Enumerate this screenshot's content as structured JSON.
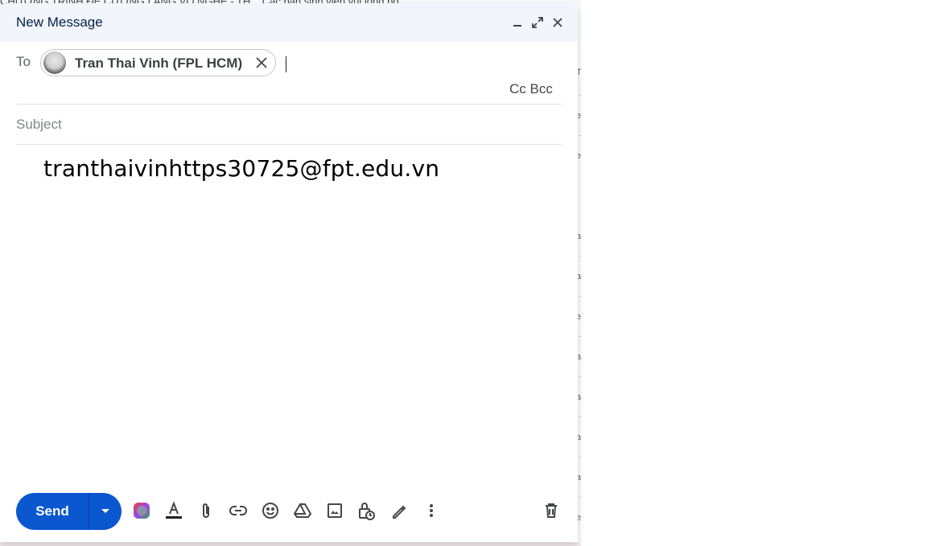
{
  "background": {
    "top_text": "CHƯƠNG TRÌNH ĐỀ CƯƠNG LÀNG VÕ NGHỆ - TH... Các bạn sinh viên vui lòng bổ ...",
    "row_letters": [
      "T",
      "e",
      "e",
      "a",
      "a",
      "e",
      "a",
      "a",
      "a",
      "a",
      "e"
    ]
  },
  "compose": {
    "title": "New Message",
    "to_label": "To",
    "recipient": {
      "name": "Tran Thai Vinh (FPL HCM)"
    },
    "cc_label": "Cc",
    "bcc_label": "Bcc",
    "subject_placeholder": "Subject",
    "body": "tranthaivinhttps30725@fpt.edu.vn",
    "send_label": "Send",
    "icons": {
      "minimize": "minimize-icon",
      "popout": "popout-icon",
      "close": "close-icon",
      "formatting": "formatting-options-icon",
      "attach": "attach-file-icon",
      "link": "insert-link-icon",
      "emoji": "insert-emoji-icon",
      "drive": "insert-drive-icon",
      "photo": "insert-photo-icon",
      "confidential": "confidential-mode-icon",
      "signature": "signature-icon",
      "more": "more-options-icon",
      "discard": "discard-draft-icon"
    }
  },
  "colors": {
    "primary": "#0b57d0",
    "header_bg": "#f2f6fc"
  }
}
